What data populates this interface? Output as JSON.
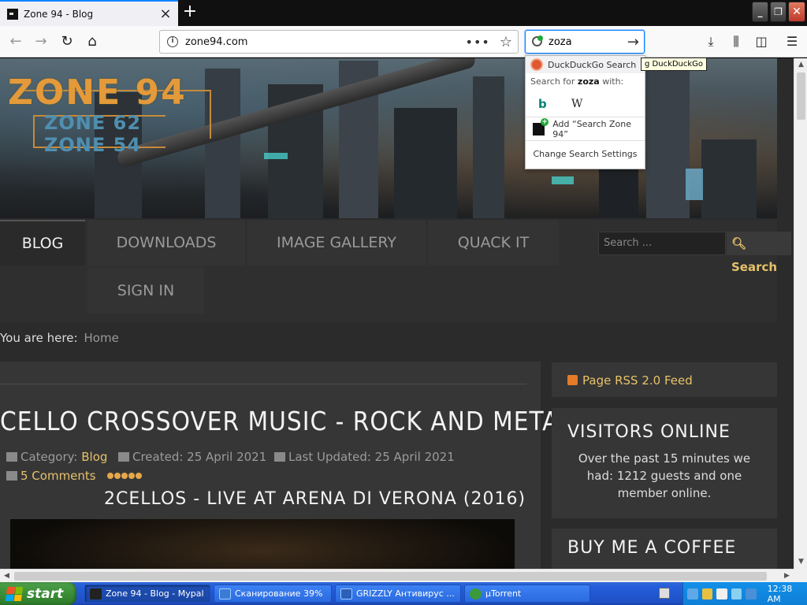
{
  "browser": {
    "tab_title": "Zone 94 - Blog",
    "new_tab_label": "+",
    "url": "zone94.com",
    "page_actions_label": "•••",
    "bookmark_star": "☆",
    "search_value": "zoza",
    "search_go": "→",
    "window_minimize": "_",
    "window_restore": "❐",
    "window_close": "✕",
    "nav": {
      "back": "←",
      "forward": "→",
      "reload": "↻",
      "home": "⌂"
    },
    "toolbar": {
      "download": "⤓",
      "library": "⫼",
      "sidebar": "◫",
      "menu": "☰"
    }
  },
  "search_dropdown": {
    "engine_label": "DuckDuckGo Search",
    "search_for_prefix": "Search for ",
    "search_for_term": "zoza",
    "search_for_suffix": " with:",
    "engine_bing": "b",
    "engine_wiki": "W",
    "add_label": "Add “Search Zone 94”",
    "settings_label": "Change Search Settings",
    "tooltip": "g DuckDuckGo"
  },
  "site": {
    "logo_main": "ZONE 94",
    "logo_sub1": "ZONE 62",
    "logo_sub2": "ZONE 54",
    "menu": [
      {
        "label": "BLOG",
        "active": true
      },
      {
        "label": "DOWNLOADS"
      },
      {
        "label": "IMAGE GALLERY"
      },
      {
        "label": "QUACK IT"
      },
      {
        "label": "SIGN IN"
      }
    ],
    "search_placeholder": "Search ...",
    "search_button": "Search",
    "breadcrumb_prefix": "You are here:",
    "breadcrumb_home": "Home"
  },
  "article": {
    "title": "CELLO CROSSOVER MUSIC - ROCK AND METAL",
    "category_label": "Category:",
    "category_value": "Blog",
    "created": "Created: 25 April 2021",
    "updated": "Last Updated: 25 April 2021",
    "comments": "5 Comments",
    "rating_stars": 5,
    "subtitle": "2CELLOS - LIVE AT ARENA DI VERONA (2016)"
  },
  "sidebar": {
    "rss_label": "Page RSS 2.0 Feed",
    "visitors_title": "VISITORS ONLINE",
    "visitors_text": "Over the past 15 minutes we had: 1212 guests and one member online.",
    "coffee_title": "BUY ME A COFFEE"
  },
  "taskbar": {
    "start_label": "start",
    "tasks": [
      {
        "label": "Zone 94 - Blog - Mypal",
        "active": true
      },
      {
        "label": "Сканирование 39%"
      },
      {
        "label": "GRIZZLY Антивирус ..."
      },
      {
        "label": "µTorrent"
      }
    ],
    "clock": "12:38 AM"
  },
  "colors": {
    "accent": "#e6c26a",
    "page_bg": "#2b2b2b",
    "panel_bg": "#363636",
    "taskbar": "#245edb",
    "start_green": "#3c8e38"
  }
}
